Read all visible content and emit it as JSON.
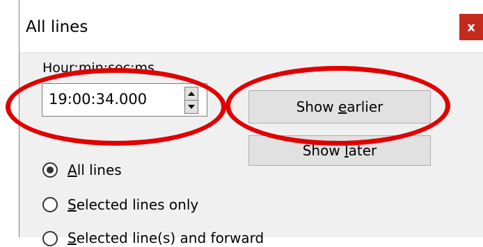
{
  "window": {
    "title": "All lines",
    "close_symbol": "x"
  },
  "time": {
    "label": "Hour:min:sec:ms",
    "value": "19:00:34.000"
  },
  "buttons": {
    "earlier": {
      "pre": "Show ",
      "key": "e",
      "post": "arlier"
    },
    "later": {
      "pre": "Show ",
      "key": "l",
      "post": "ater"
    }
  },
  "radios": [
    {
      "key": "A",
      "rest": "ll lines",
      "checked": true
    },
    {
      "key": "S",
      "rest": "elected lines only",
      "checked": false
    },
    {
      "key": "S",
      "rest": "elected line(s) and forward",
      "checked": false
    }
  ],
  "annotation_color": "#e00000",
  "icons": {
    "close": "close-icon",
    "spin_up": "chevron-up-icon",
    "spin_down": "chevron-down-icon"
  }
}
